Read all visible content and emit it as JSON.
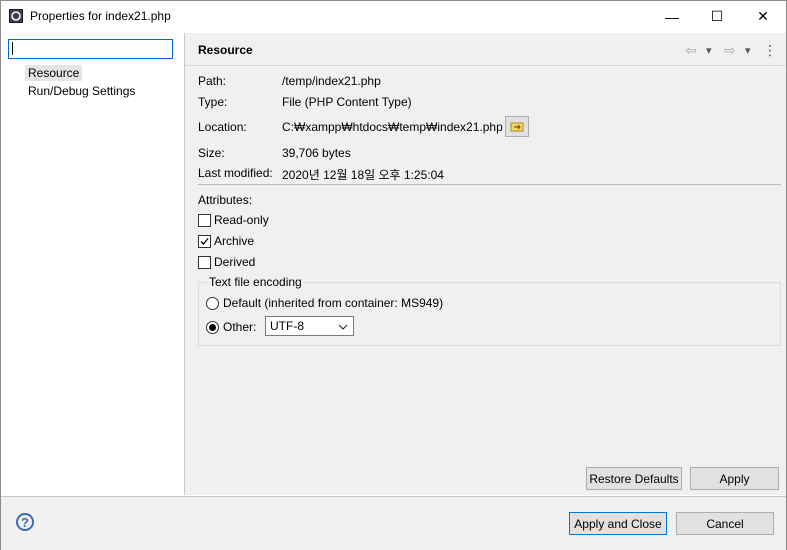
{
  "window": {
    "title": "Properties for index21.php",
    "minimize": "—",
    "maximize": "☐",
    "close": "✕"
  },
  "sidebar": {
    "filter_value": "",
    "items": [
      {
        "label": "Resource",
        "selected": true
      },
      {
        "label": "Run/Debug Settings",
        "selected": false
      }
    ]
  },
  "page": {
    "title": "Resource",
    "nav": {
      "back": "⇦",
      "back_menu": "▾",
      "forward": "⇨",
      "forward_menu": "▾",
      "more": "⋮"
    },
    "fields": [
      {
        "label": "Path:",
        "value": "/temp/index21.php"
      },
      {
        "label": "Type:",
        "value": "File  (PHP Content Type)"
      },
      {
        "label": "Location:",
        "value": "C:₩xampp₩htdocs₩temp₩index21.php"
      },
      {
        "label": "Size:",
        "value": "39,706  bytes"
      },
      {
        "label": "Last modified:",
        "value": "2020년 12월 18일 오후 1:25:04"
      }
    ],
    "attributes_label": "Attributes:",
    "attributes": [
      {
        "label": "Read-only",
        "checked": false
      },
      {
        "label": "Archive",
        "checked": true
      },
      {
        "label": "Derived",
        "checked": false
      }
    ],
    "encoding": {
      "group_title": "Text file encoding",
      "default_label": "Default (inherited from container: MS949)",
      "other_label": "Other:",
      "selected": "other",
      "other_value": "UTF-8"
    },
    "restore_defaults": "Restore Defaults",
    "apply": "Apply"
  },
  "footer": {
    "help": "?",
    "apply_and_close": "Apply and Close",
    "cancel": "Cancel"
  }
}
